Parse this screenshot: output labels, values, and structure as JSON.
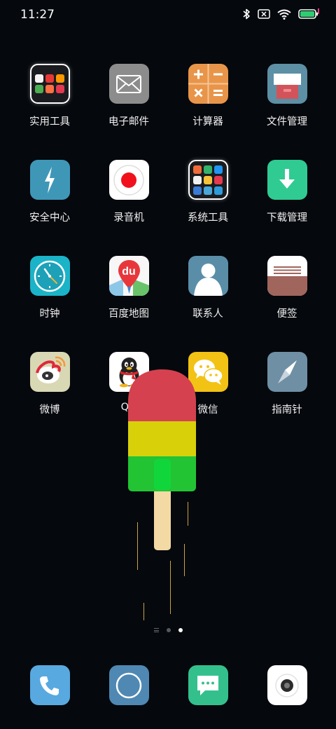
{
  "status_bar": {
    "time": "11:27",
    "icons": [
      "bluetooth-icon",
      "no-sim-icon",
      "wifi-icon",
      "battery-icon"
    ],
    "battery_color": "#2ecc71"
  },
  "apps": {
    "utilities": {
      "label": "实用工具",
      "icon": "folder-icon"
    },
    "email": {
      "label": "电子邮件",
      "icon": "envelope-icon"
    },
    "calculator": {
      "label": "计算器",
      "icon": "calculator-icon"
    },
    "file_manager": {
      "label": "文件管理",
      "icon": "file-manager-icon"
    },
    "security_center": {
      "label": "安全中心",
      "icon": "lightning-icon"
    },
    "recorder": {
      "label": "录音机",
      "icon": "record-icon"
    },
    "system_tools": {
      "label": "系统工具",
      "icon": "folder-icon"
    },
    "download_manager": {
      "label": "下载管理",
      "icon": "download-icon"
    },
    "clock": {
      "label": "时钟",
      "icon": "clock-icon"
    },
    "baidu_map": {
      "label": "百度地图",
      "icon": "map-pin-icon",
      "logo_text": "du"
    },
    "contacts": {
      "label": "联系人",
      "icon": "person-icon"
    },
    "notes": {
      "label": "便签",
      "icon": "notes-icon"
    },
    "weibo": {
      "label": "微博",
      "icon": "weibo-icon"
    },
    "qq": {
      "label": "QQ",
      "icon": "penguin-icon"
    },
    "wechat": {
      "label": "微信",
      "icon": "chat-bubbles-icon"
    },
    "compass": {
      "label": "指南针",
      "icon": "compass-icon"
    }
  },
  "pager": {
    "pages": 2,
    "current": 2
  },
  "dock": [
    {
      "name": "phone",
      "icon": "phone-icon"
    },
    {
      "name": "browser",
      "icon": "circle-icon"
    },
    {
      "name": "messages",
      "icon": "message-icon"
    },
    {
      "name": "camera",
      "icon": "camera-icon"
    }
  ],
  "colors": {
    "background": "#05080d",
    "popsicle_top": "#d5414f",
    "popsicle_middle": "#d8d10a",
    "popsicle_bottom": "#22c434",
    "popsicle_stick": "#f3d9a4"
  }
}
